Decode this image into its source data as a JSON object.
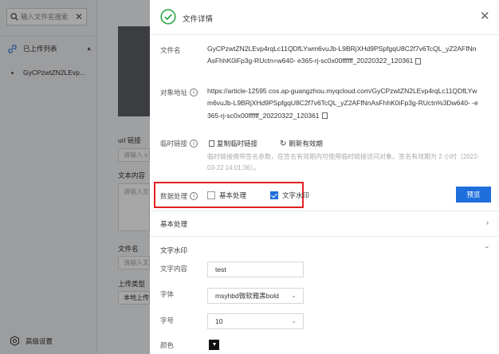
{
  "sidebar": {
    "search_placeholder": "输入文件名搜索",
    "list_title": "已上传列表",
    "item_name": "GyCPzwtZN2LEvp...",
    "advanced": "高级设置"
  },
  "main": {
    "url_label": "url 链接",
    "url_placeholder": "请输入 u",
    "text_label": "文本内容",
    "text_placeholder": "请输入文",
    "filename_label": "文件名",
    "filename_placeholder": "请输入文",
    "upload_type_label": "上传类型",
    "upload_type_value": "本地上传"
  },
  "drawer": {
    "title": "文件详情",
    "filename_label": "文件名",
    "filename_value": "GyCPzwtZN2LEvp4rqLc11QDfLYwm6vuJb-L9BRjXHd9PSpfgqU8C2f7v6TcQL_yZ2AFfNnAsFhhK0iFp3g-RUctn=w640-      e365-rj-sc0x00ffffff_20220322_120361",
    "object_label": "对象地址",
    "object_value": "https://article-12595           cos.ap-guangzhou.myqcloud.com/GyCPzwtZN2LEvp4rqLc11QDfLYwm6vuJb-L9BRjXHd9PSpfgqU8C2f7v6TcQL_yZ2AFfNnAsFhhK0iFp3g-RUctn%3Dw640-       -e365-rj-sc0x00ffffff_20220322_120361",
    "temp_label": "临时链接",
    "copy_temp": "复制临时链接",
    "refresh": "刷新有效期",
    "hint": "临时链接携带签名参数，在签名有效期内可使用临时链接访问对象。签名有效期为 2 小时（2022-03-22 14:01:36）。",
    "process_label": "数据处理",
    "basic_cb": "基本处理",
    "watermark_cb": "文字水印",
    "preview": "预览",
    "basic_section": "基本处理",
    "watermark_section": "文字水印",
    "text_content_label": "文字内容",
    "text_content_value": "test",
    "font_label": "字体",
    "font_value": "msyhbd微软雅黑bold",
    "size_label": "字号",
    "size_value": "10",
    "color_label": "颜色"
  },
  "colors": {
    "accent": "#1e6fdc",
    "success": "#2ea84a",
    "highlight": "#e02020"
  },
  "checkboxes": {
    "basic": false,
    "watermark": true
  }
}
